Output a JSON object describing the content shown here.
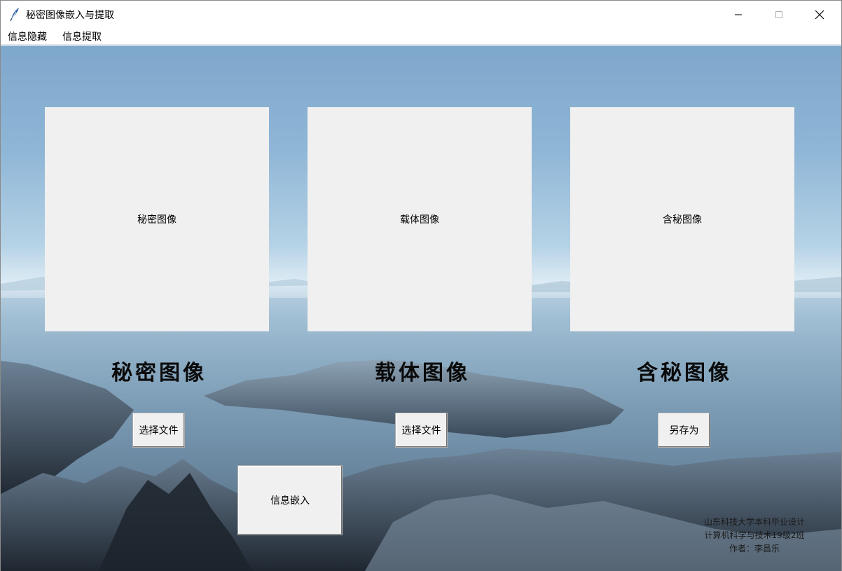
{
  "window": {
    "title": "秘密图像嵌入与提取",
    "icon": "feather-icon"
  },
  "menu": {
    "items": [
      "信息隐藏",
      "信息提取"
    ]
  },
  "panels": [
    {
      "placeholder": "秘密图像",
      "label": "秘密图像",
      "button": "选择文件"
    },
    {
      "placeholder": "载体图像",
      "label": "载体图像",
      "button": "选择文件"
    },
    {
      "placeholder": "含秘图像",
      "label": "含秘图像",
      "button": "另存为"
    }
  ],
  "embed_button": "信息嵌入",
  "credits": [
    "山东科技大学本科毕业设计",
    "计算机科学与技术19级2班",
    "作者：李昌乐"
  ]
}
